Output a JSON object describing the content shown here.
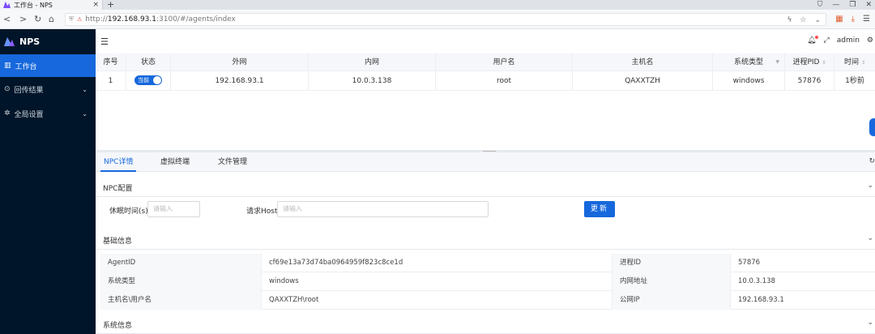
{
  "browser": {
    "tab_title": "工作台 - NPS",
    "url_prefix": "http://",
    "url_host": "192.168.93.1",
    "url_rest": ":3100/#/agents/index",
    "new_tab": "+",
    "minimize": "—",
    "restore": "❐",
    "close": "✕"
  },
  "sidebar": {
    "brand": "NPS",
    "items": [
      {
        "label": "工作台",
        "icon": "dashboard-icon",
        "active": true
      },
      {
        "label": "回传结果",
        "icon": "history-icon",
        "active": false
      },
      {
        "label": "全局设置",
        "icon": "gear-icon",
        "active": false
      }
    ]
  },
  "header": {
    "user": "admin"
  },
  "table": {
    "columns": [
      {
        "label": "序号",
        "sort": false
      },
      {
        "label": "状态",
        "sort": false
      },
      {
        "label": "外网",
        "sort": false
      },
      {
        "label": "内网",
        "sort": false
      },
      {
        "label": "用户名",
        "sort": false
      },
      {
        "label": "主机名",
        "sort": false
      },
      {
        "label": "系统类型",
        "sort": false,
        "filter": true
      },
      {
        "label": "进程PID",
        "sort": true
      },
      {
        "label": "时间",
        "sort": true
      }
    ],
    "rows": [
      {
        "index": "1",
        "status_label": "当前",
        "status_on": true,
        "external": "192.168.93.1",
        "internal": "10.0.3.138",
        "user": "root",
        "host": "QAXXTZH",
        "os": "windows",
        "pid": "57876",
        "time": "1秒前"
      }
    ]
  },
  "bottom_tabs": {
    "tabs": [
      "NPC详情",
      "虚拟终端",
      "文件管理"
    ],
    "active": 0
  },
  "npc_config": {
    "title": "NPC配置",
    "sleep_label": "休眠时间(s)",
    "sleep_placeholder": "请输入",
    "host_label": "请求Host",
    "host_placeholder": "请输入",
    "update_button": "更新"
  },
  "basic_info": {
    "title": "基础信息",
    "rows": [
      {
        "l1": "AgentID",
        "v1": "cf69e13a73d74ba0964959f823c8ce1d",
        "l2": "进程ID",
        "v2": "57876"
      },
      {
        "l1": "系统类型",
        "v1": "windows",
        "l2": "内网地址",
        "v2": "10.0.3.138"
      },
      {
        "l1": "主机名\\用户名",
        "v1": "QAXXTZH\\root",
        "l2": "公网IP",
        "v2": "192.168.93.1"
      }
    ]
  },
  "system_info": {
    "title": "系统信息"
  },
  "colors": {
    "primary": "#1668dc",
    "sidebar_bg": "#001529"
  }
}
